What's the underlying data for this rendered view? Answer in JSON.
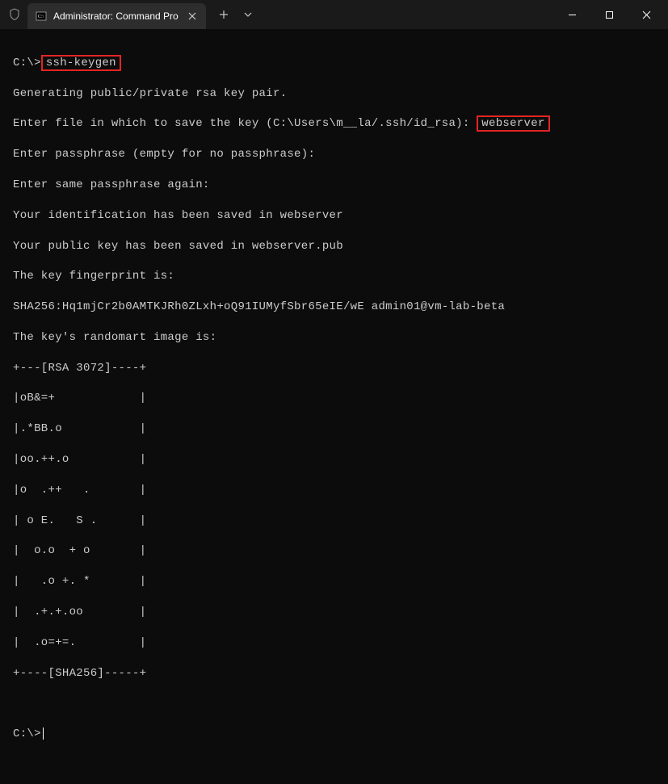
{
  "titlebar": {
    "tab_title": "Administrator: Command Pro"
  },
  "terminal": {
    "line1_prompt": "C:\\>",
    "line1_cmd": "ssh-keygen",
    "line2": "Generating public/private rsa key pair.",
    "line3_prefix": "Enter file in which to save the key (C:\\Users\\m__la/.ssh/id_rsa):",
    "line3_input": "webserver",
    "line4": "Enter passphrase (empty for no passphrase):",
    "line5": "Enter same passphrase again:",
    "line6": "Your identification has been saved in webserver",
    "line7": "Your public key has been saved in webserver.pub",
    "line8": "The key fingerprint is:",
    "line9": "SHA256:Hq1mjCr2b0AMTKJRh0ZLxh+oQ91IUMyfSbr65eIE/wE admin01@vm-lab-beta",
    "line10": "The key's randomart image is:",
    "art1": "+---[RSA 3072]----+",
    "art2": "|oB&=+            |",
    "art3": "|.*BB.o           |",
    "art4": "|oo.++.o          |",
    "art5": "|o  .++   .       |",
    "art6": "| o E.   S .      |",
    "art7": "|  o.o  + o       |",
    "art8": "|   .o +. *       |",
    "art9": "|  .+.+.oo        |",
    "art10": "|  .o=+=.         |",
    "art11": "+----[SHA256]-----+",
    "final_prompt": "C:\\>"
  }
}
